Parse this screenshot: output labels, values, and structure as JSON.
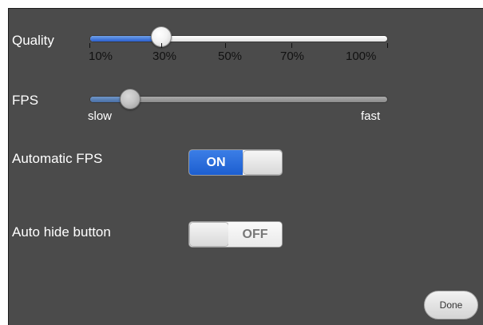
{
  "settings": {
    "quality": {
      "label": "Quality",
      "value_percent": 30,
      "ticks": [
        "10%",
        "30%",
        "50%",
        "70%",
        "100%"
      ]
    },
    "fps": {
      "label": "FPS",
      "value_fraction": 0.12,
      "min_label": "slow",
      "max_label": "fast"
    },
    "automatic_fps": {
      "label": "Automatic FPS",
      "state": "ON",
      "on_text": "ON"
    },
    "auto_hide_button": {
      "label": "Auto hide button",
      "state": "OFF",
      "off_text": "OFF"
    }
  },
  "footer": {
    "done_label": "Done"
  },
  "colors": {
    "panel_background": "#4b4b4b",
    "switch_on_blue": "#1d5fd0",
    "slider_fill_blue": "#2a5fcf"
  }
}
